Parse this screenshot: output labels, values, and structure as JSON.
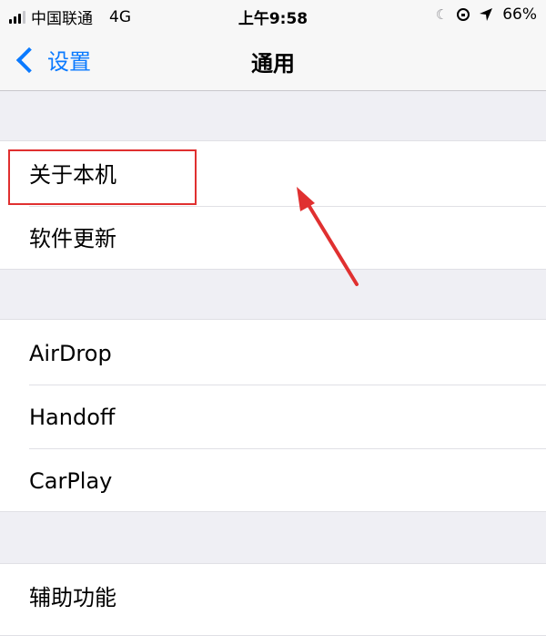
{
  "status_bar": {
    "carrier": "中国联通",
    "network": "4G",
    "time": "上午9:58",
    "battery": "66%"
  },
  "nav": {
    "back_label": "设置",
    "title": "通用"
  },
  "groups": [
    {
      "items": [
        "关于本机",
        "软件更新"
      ]
    },
    {
      "items": [
        "AirDrop",
        "Handoff",
        "CarPlay"
      ]
    },
    {
      "items": [
        "辅助功能"
      ]
    }
  ],
  "annotation_color": "#e03030",
  "accent_color": "#0a7aff"
}
